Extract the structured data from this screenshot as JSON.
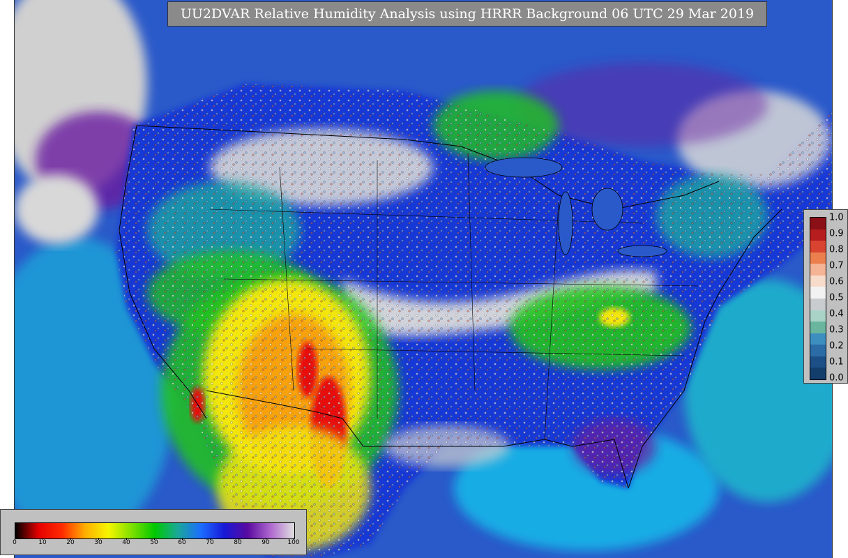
{
  "title": "UU2DVAR Relative Humidity Analysis using HRRR Background 06 UTC 29 Mar 2019",
  "colors": {
    "ocean": "#2a59c9",
    "dry_red": "#e8100f",
    "orange": "#f7a10e",
    "yellow": "#f3e70f",
    "green": "#21c41f",
    "teal": "#1ba9a2",
    "blue": "#1937d6",
    "purple": "#6a1aa0",
    "moist_white": "#d8d8d8",
    "panel_gray": "#c0c0c0",
    "title_gray": "#8a8a8a"
  },
  "rh_colorbar": {
    "ticks": [
      "0",
      "10",
      "20",
      "30",
      "40",
      "50",
      "60",
      "70",
      "80",
      "90",
      "100"
    ],
    "stops": [
      "#000000",
      "#e50000",
      "#ff2a00",
      "#ffae00",
      "#f6f600",
      "#7fe000",
      "#00c800",
      "#1aa79b",
      "#1b6cff",
      "#1818d6",
      "#5a0aa0",
      "#b06ad0",
      "#e0e0e0"
    ]
  },
  "obs_colorbar": {
    "ticks": [
      "1.0",
      "0.9",
      "0.8",
      "0.7",
      "0.6",
      "0.5",
      "0.4",
      "0.3",
      "0.2",
      "0.1",
      "0.0"
    ],
    "band_colors": [
      "#8b0f17",
      "#b51d1f",
      "#d94431",
      "#ec7f4e",
      "#f4b394",
      "#f7dccc",
      "#f2f2f2",
      "#c9cccf",
      "#a8d3c6",
      "#69b59e",
      "#3d8fc0",
      "#2c6ca6",
      "#1c4f85",
      "#133d6a"
    ]
  }
}
